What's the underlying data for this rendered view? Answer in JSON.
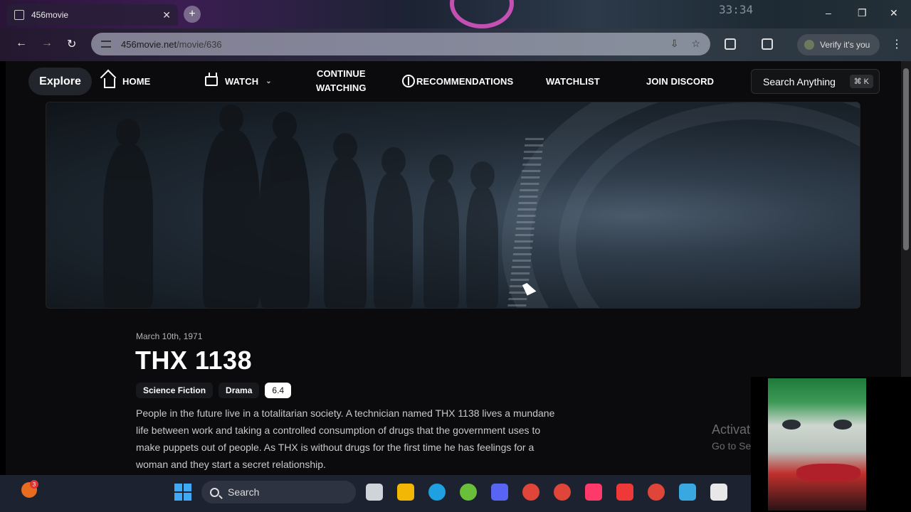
{
  "browser": {
    "tab_title": "456movie",
    "tab_close": "✕",
    "new_tab": "+",
    "url_host": "456movie.net",
    "url_path": "/movie/636",
    "verify_label": "Verify it's you",
    "window_controls": [
      "–",
      "❐",
      "✕"
    ]
  },
  "nav": {
    "explore": "Explore",
    "home": "HOME",
    "watch": "WATCH",
    "continue_line1": "CONTINUE",
    "continue_line2": "WATCHING",
    "recommendations": "RECOMMENDATIONS",
    "watchlist": "WATCHLIST",
    "discord": "JOIN DISCORD",
    "search_label": "Search Anything",
    "search_shortcut": "⌘ K"
  },
  "movie": {
    "release_date": "March 10th, 1971",
    "title": "THX 1138",
    "genres": [
      "Science Fiction",
      "Drama"
    ],
    "rating": "6.4",
    "overview": "People in the future live in a totalitarian society. A technician named THX 1138 lives a mundane life between work and taking a controlled consumption of drugs that the government uses to make puppets out of people. As THX is without drugs for the first time he has feelings for a woman and they start a secret relationship."
  },
  "watermark": {
    "line1": "Activat",
    "line2": "Go to Se"
  },
  "taskbar": {
    "search_label": "Search",
    "weather_badge": "3",
    "apps": [
      "task-view",
      "file-explorer",
      "edge",
      "utorrent",
      "discord",
      "chrome",
      "chrome-2",
      "affinity",
      "vivaldi",
      "chrome-active",
      "notepad",
      "snipping-tool"
    ],
    "app_colors": [
      "#cfd3da",
      "#f2b705",
      "#1fa0e0",
      "#6abf3a",
      "#5865f2",
      "#e0453a",
      "#e0453a",
      "#ff3a6a",
      "#ef3939",
      "#e0453a",
      "#39a7e0",
      "#e8e8e8"
    ]
  },
  "overlay_clock": "33:34"
}
